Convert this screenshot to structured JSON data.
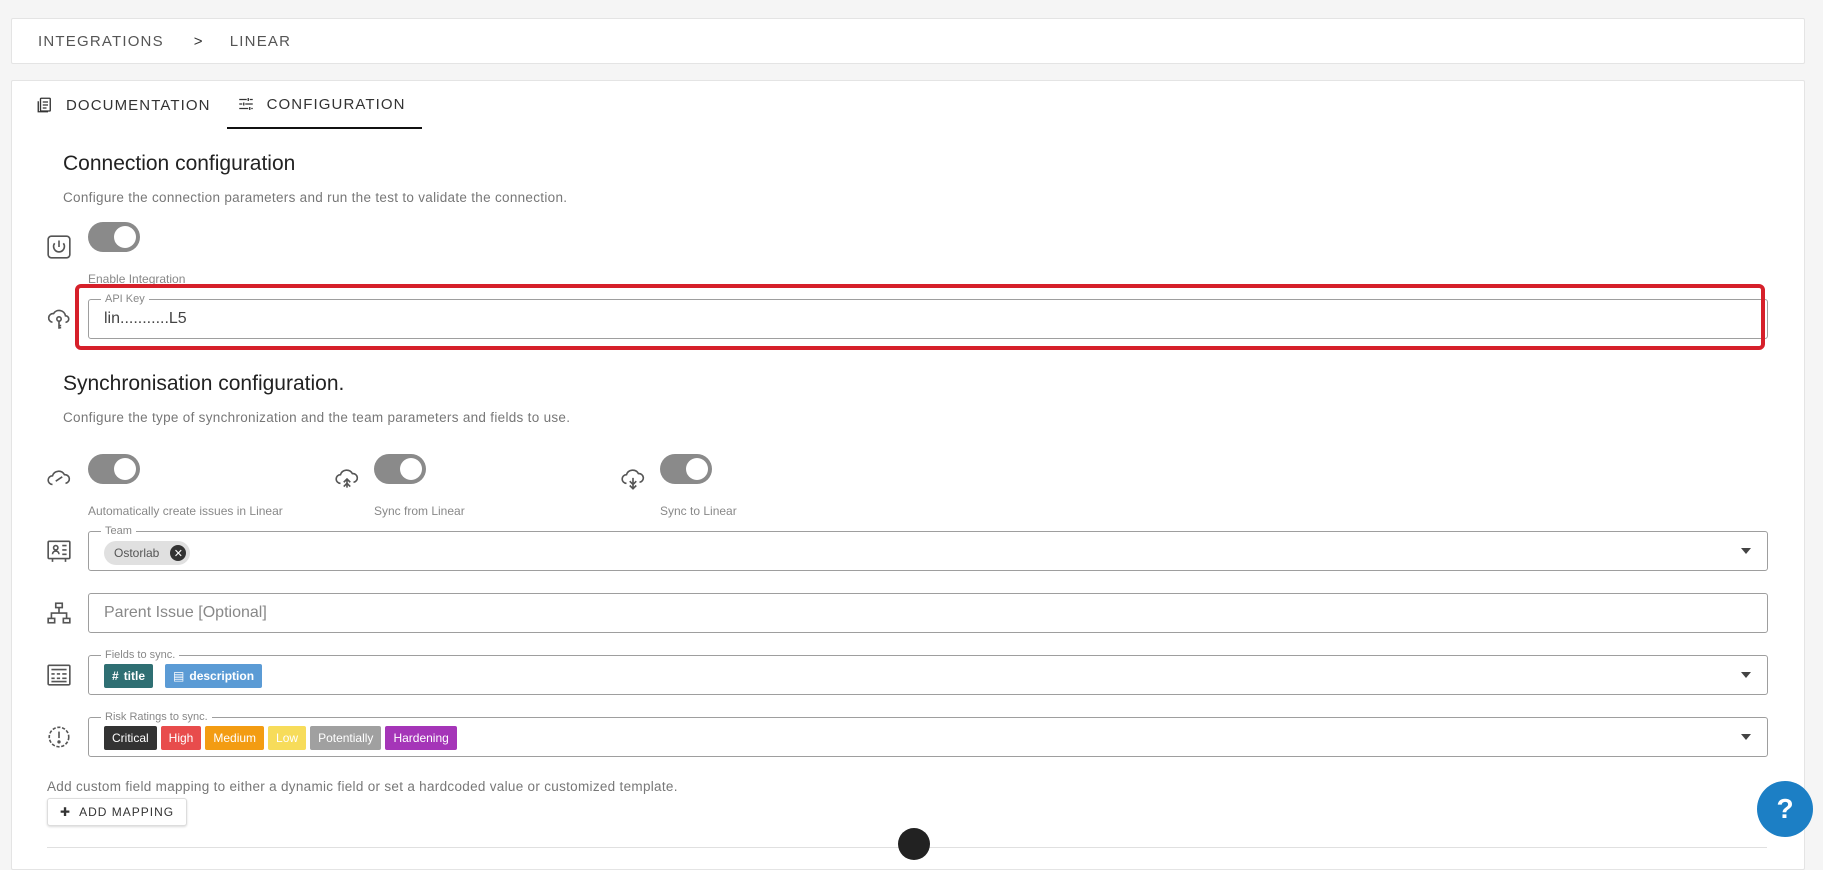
{
  "breadcrumb": {
    "root": "INTEGRATIONS",
    "separator": ">",
    "current": "LINEAR"
  },
  "tabs": [
    {
      "label": "DOCUMENTATION",
      "icon": "document-icon"
    },
    {
      "label": "CONFIGURATION",
      "icon": "sliders-icon",
      "active": true
    }
  ],
  "connection": {
    "title": "Connection configuration",
    "subtitle": "Configure the connection parameters and run the test to validate the connection.",
    "enable_label": "Enable Integration",
    "enable_on": true,
    "api_key_legend": "API Key",
    "api_key_value": "lin...........L5"
  },
  "sync": {
    "title": "Synchronisation configuration.",
    "subtitle": "Configure the type of synchronization and the team parameters and fields to use.",
    "toggles": [
      {
        "label": "Automatically create issues in Linear",
        "on": true,
        "icon": "cloud-link-icon"
      },
      {
        "label": "Sync from Linear",
        "on": true,
        "icon": "cloud-upload-icon"
      },
      {
        "label": "Sync to Linear",
        "on": true,
        "icon": "cloud-download-icon"
      }
    ],
    "team_legend": "Team",
    "team_chip": "Ostorlab",
    "parent_placeholder": "Parent Issue [Optional]",
    "fields_legend": "Fields to sync.",
    "fields": [
      {
        "label": "title",
        "prefix": "#",
        "color": "#2f6f73"
      },
      {
        "label": "description",
        "prefix": "▤",
        "color": "#5b9bd5"
      }
    ],
    "risk_legend": "Risk Ratings to sync.",
    "risks": [
      {
        "label": "Critical",
        "color": "#333333"
      },
      {
        "label": "High",
        "color": "#e84c4c"
      },
      {
        "label": "Medium",
        "color": "#f39c12"
      },
      {
        "label": "Low",
        "color": "#f7dc5a"
      },
      {
        "label": "Potentially",
        "color": "#a0a0a0"
      },
      {
        "label": "Hardening",
        "color": "#a535b8"
      }
    ]
  },
  "mapping": {
    "hint": "Add custom field mapping to either a dynamic field or set a hardcoded value or customized template.",
    "button": "ADD MAPPING"
  },
  "help_label": "?"
}
